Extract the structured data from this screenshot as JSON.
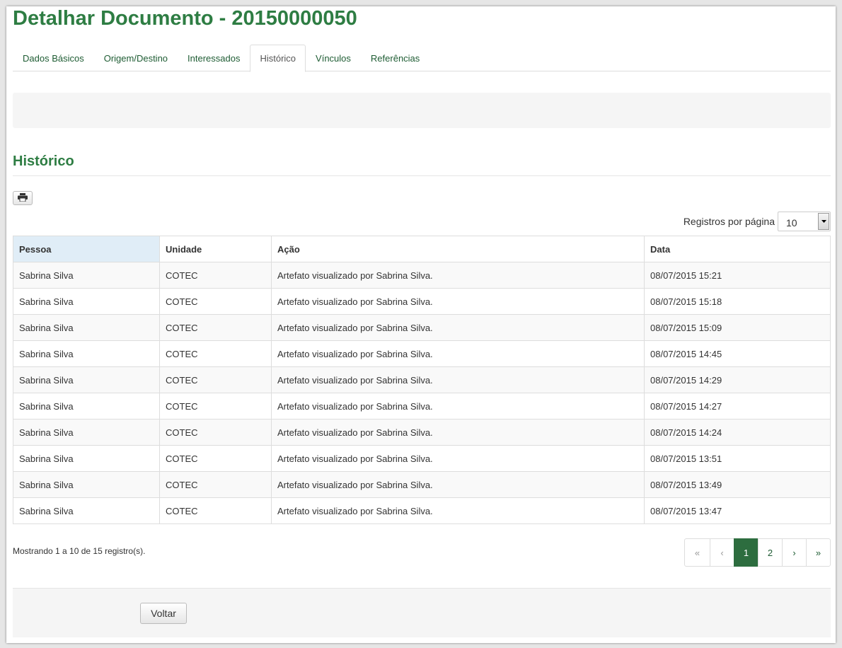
{
  "page": {
    "title": "Detalhar Documento - 20150000050"
  },
  "tabs": [
    {
      "label": "Dados Básicos",
      "active": false
    },
    {
      "label": "Origem/Destino",
      "active": false
    },
    {
      "label": "Interessados",
      "active": false
    },
    {
      "label": "Histórico",
      "active": true
    },
    {
      "label": "Vínculos",
      "active": false
    },
    {
      "label": "Referências",
      "active": false
    }
  ],
  "section": {
    "title": "Histórico",
    "print_icon": "print-icon"
  },
  "perpage": {
    "label": "Registros por página",
    "value": "10"
  },
  "table": {
    "columns": [
      "Pessoa",
      "Unidade",
      "Ação",
      "Data"
    ],
    "sorted_column": "Pessoa",
    "rows": [
      [
        "Sabrina Silva",
        "COTEC",
        "Artefato visualizado por Sabrina Silva.",
        "08/07/2015 15:21"
      ],
      [
        "Sabrina Silva",
        "COTEC",
        "Artefato visualizado por Sabrina Silva.",
        "08/07/2015 15:18"
      ],
      [
        "Sabrina Silva",
        "COTEC",
        "Artefato visualizado por Sabrina Silva.",
        "08/07/2015 15:09"
      ],
      [
        "Sabrina Silva",
        "COTEC",
        "Artefato visualizado por Sabrina Silva.",
        "08/07/2015 14:45"
      ],
      [
        "Sabrina Silva",
        "COTEC",
        "Artefato visualizado por Sabrina Silva.",
        "08/07/2015 14:29"
      ],
      [
        "Sabrina Silva",
        "COTEC",
        "Artefato visualizado por Sabrina Silva.",
        "08/07/2015 14:27"
      ],
      [
        "Sabrina Silva",
        "COTEC",
        "Artefato visualizado por Sabrina Silva.",
        "08/07/2015 14:24"
      ],
      [
        "Sabrina Silva",
        "COTEC",
        "Artefato visualizado por Sabrina Silva.",
        "08/07/2015 13:51"
      ],
      [
        "Sabrina Silva",
        "COTEC",
        "Artefato visualizado por Sabrina Silva.",
        "08/07/2015 13:49"
      ],
      [
        "Sabrina Silva",
        "COTEC",
        "Artefato visualizado por Sabrina Silva.",
        "08/07/2015 13:47"
      ]
    ]
  },
  "summary": "Mostrando 1 a 10 de 15 registro(s).",
  "pager": {
    "first": "«",
    "prev": "‹",
    "pages": [
      "1",
      "2"
    ],
    "current": "1",
    "next": "›",
    "last": "»"
  },
  "footer": {
    "back_label": "Voltar"
  },
  "colors": {
    "brand": "#2e7d43",
    "active_page": "#2d6d3f",
    "sorted_header": "#e0edf7"
  }
}
